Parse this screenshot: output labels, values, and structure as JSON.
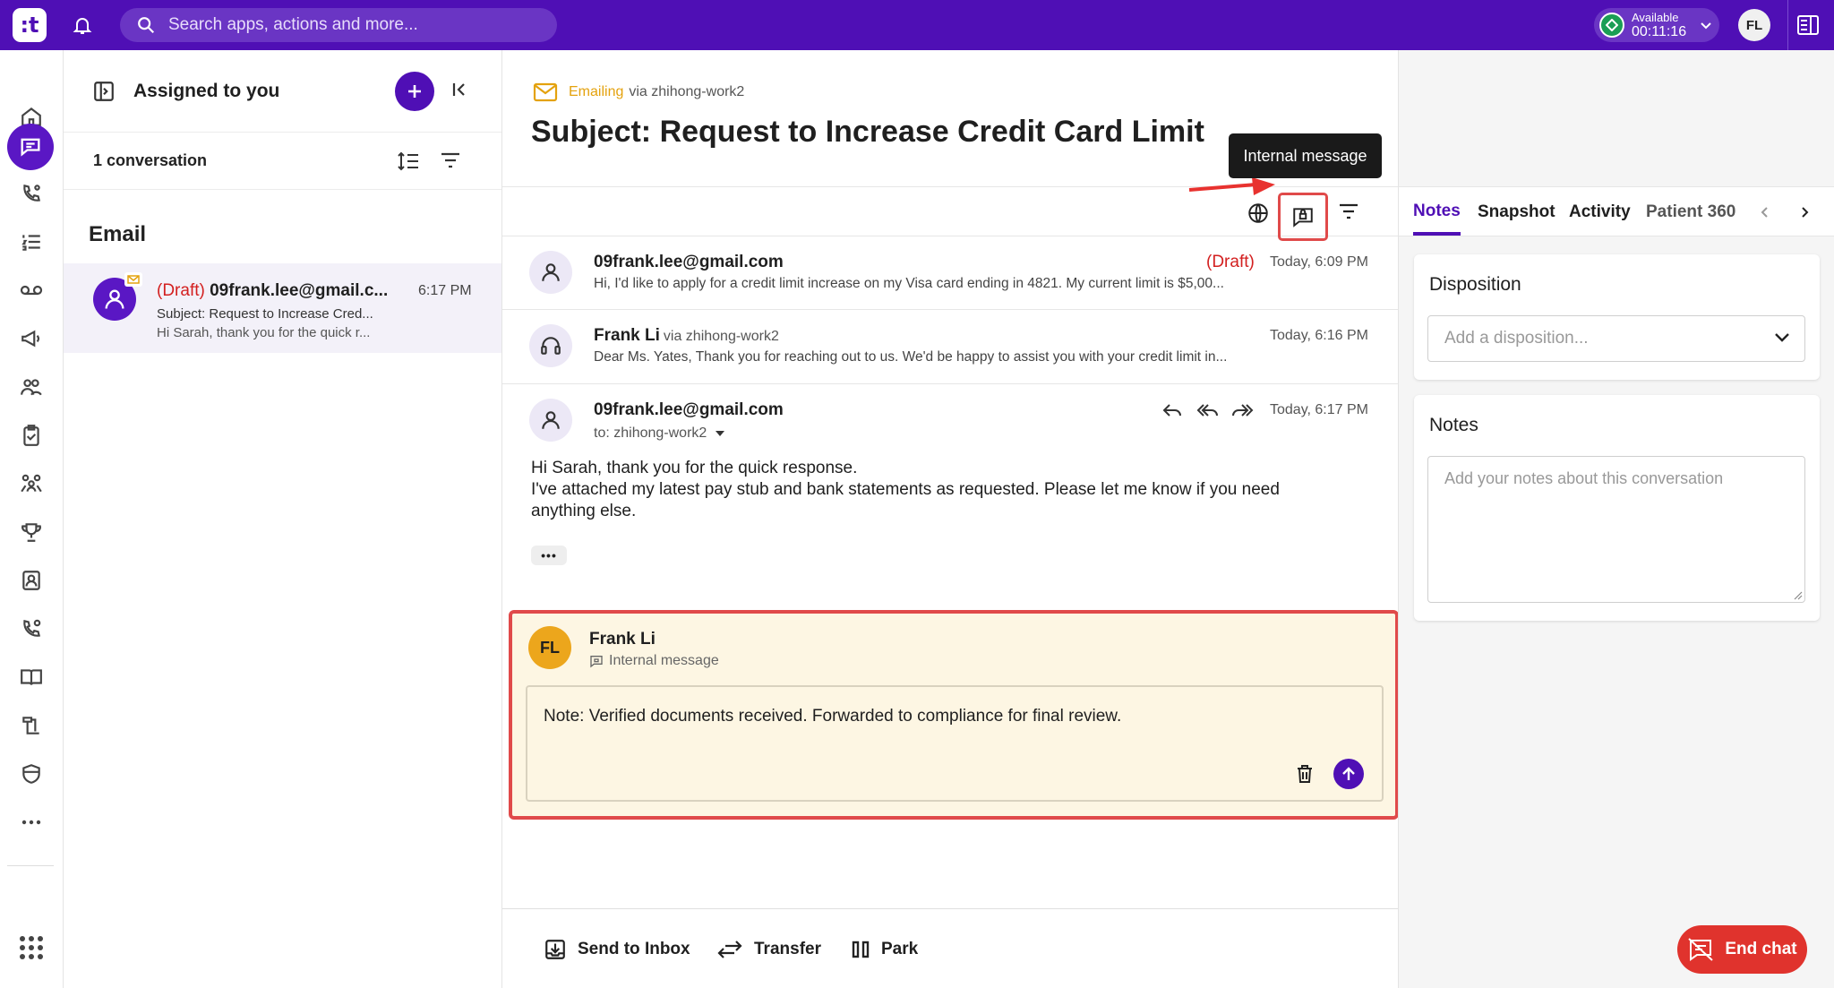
{
  "topbar": {
    "logo_text": ":t",
    "search_placeholder": "Search apps, actions and more...",
    "status_label": "Available",
    "status_timer": "00:11:16",
    "avatar_initials": "FL"
  },
  "conversation_list": {
    "title": "Assigned to you",
    "count_label": "1 conversation",
    "section_label": "Email",
    "items": [
      {
        "draft_tag": "(Draft)",
        "sender": "09frank.lee@gmail.c...",
        "time": "6:17 PM",
        "subject": "Subject: Request to Increase Cred...",
        "snippet": "Hi Sarah, thank you for the quick r..."
      }
    ]
  },
  "main": {
    "channel": "Emailing",
    "channel_via": "via zhihong-work2",
    "subject": "Subject: Request to Increase Credit Card Limit",
    "tooltip": "Internal message",
    "messages": [
      {
        "from": "09frank.lee@gmail.com",
        "draft": "(Draft)",
        "time": "Today, 6:09 PM",
        "preview": "Hi, I'd like to apply for a credit limit increase on my Visa card ending in 4821. My current limit is $5,00..."
      },
      {
        "from": "Frank Li",
        "via": "via zhihong-work2",
        "time": "Today, 6:16 PM",
        "preview": "Dear Ms. Yates, Thank you for reaching out to us. We'd be happy to assist you with your credit limit in..."
      },
      {
        "from": "09frank.lee@gmail.com",
        "to": "to: zhihong-work2",
        "time": "Today, 6:17 PM",
        "body_line1": "Hi Sarah, thank you for the quick response.",
        "body_line2": "I've attached my latest pay stub and bank statements as requested. Please let me know if you need anything else.",
        "more_label": "•••"
      }
    ],
    "internal_note": {
      "avatar_initials": "FL",
      "author": "Frank Li",
      "type_label": "Internal message",
      "text": "Note: Verified documents received. Forwarded to compliance for final review."
    },
    "bottom_actions": {
      "send_to_inbox": "Send to Inbox",
      "transfer": "Transfer",
      "park": "Park"
    }
  },
  "right_panel": {
    "tabs": [
      "Notes",
      "Snapshot",
      "Activity",
      "Patient 360"
    ],
    "disposition_title": "Disposition",
    "disposition_placeholder": "Add a disposition...",
    "notes_title": "Notes",
    "notes_placeholder": "Add your notes about this conversation"
  },
  "end_chat_label": "End chat",
  "colors": {
    "brand": "#4f0fb5",
    "danger": "#e0332d",
    "draft": "#d32020",
    "available": "#1a9e55",
    "note_background": "#fdf6e3"
  }
}
